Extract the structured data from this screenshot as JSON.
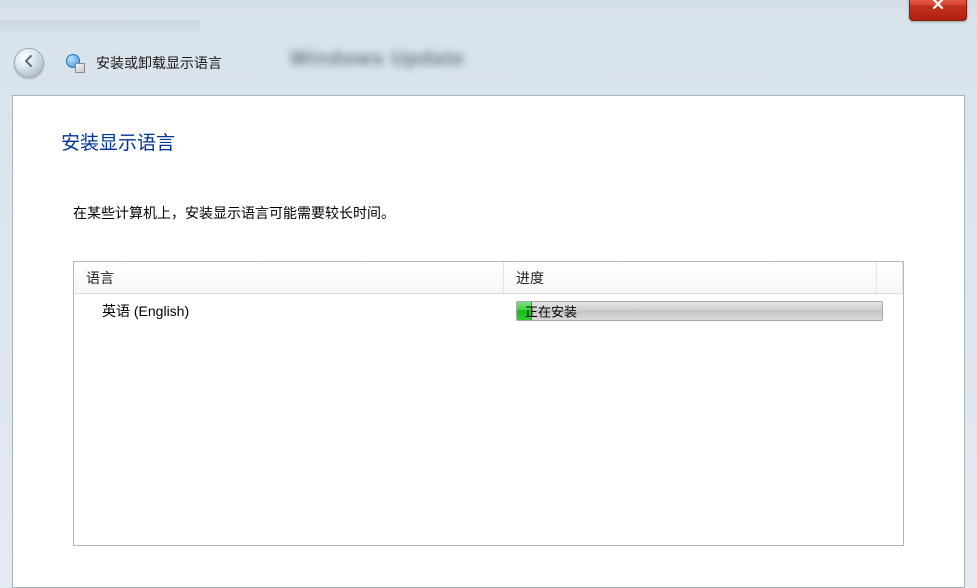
{
  "window": {
    "blurred_app_name": "Windows Update",
    "nav_title": "安装或卸载显示语言"
  },
  "colors": {
    "heading": "#003399",
    "progress_green": "#2fcf2f"
  },
  "page": {
    "heading": "安装显示语言",
    "description": "在某些计算机上，安装显示语言可能需要较长时间。"
  },
  "table": {
    "header_language": "语言",
    "header_progress": "进度",
    "rows": [
      {
        "language": "英语 (English)",
        "status_label": "正在安装",
        "progress_percent": 4
      }
    ]
  }
}
